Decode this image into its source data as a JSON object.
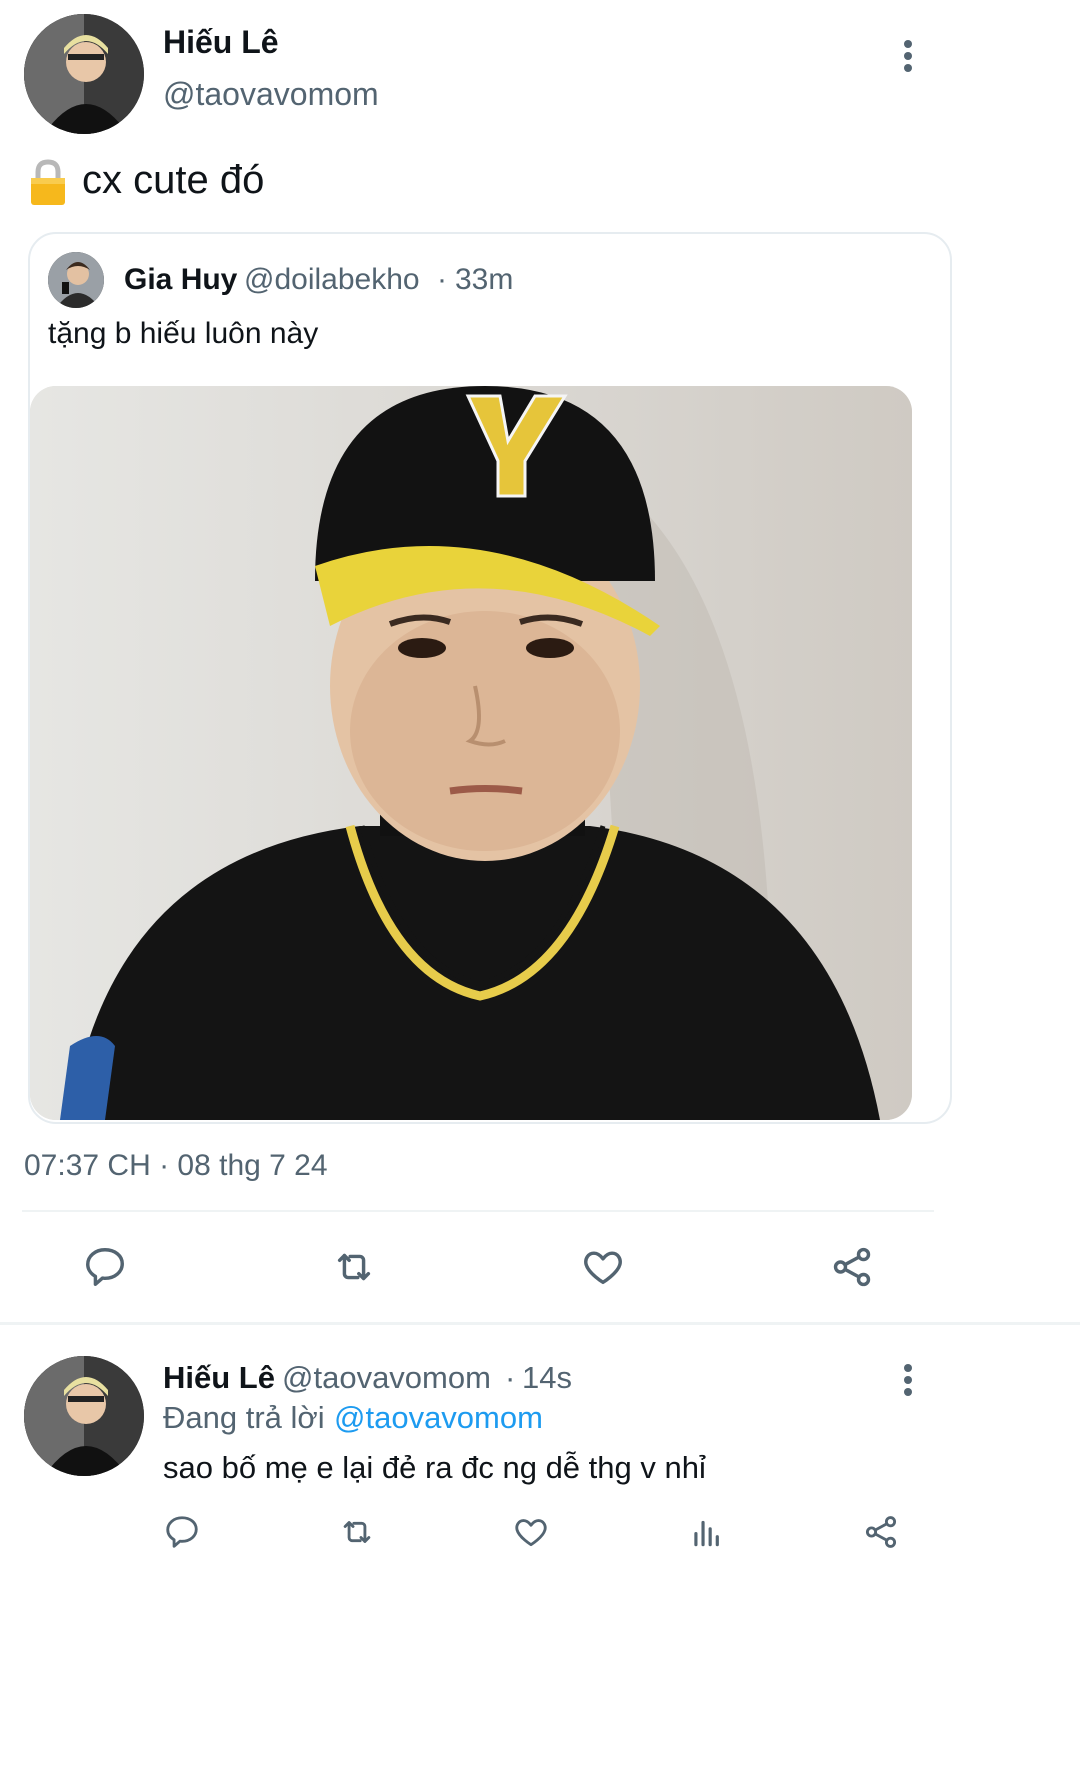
{
  "main_tweet": {
    "author_name": "Hiếu Lê",
    "author_handle": "@taovavomom",
    "text_icon": "lock-icon",
    "text": "cx cute đó",
    "quoted": {
      "author_name": "Gia Huy",
      "author_handle": "@doilabekho",
      "separator": "·",
      "time_ago": "33m",
      "text": "tặng b hiếu luôn này",
      "image": "photo-boy-in-yellow-black-cap"
    },
    "timestamp": "07:37 CH · 08 thg 7 24",
    "actions": [
      "reply-icon",
      "retweet-icon",
      "like-icon",
      "share-icon"
    ]
  },
  "reply_tweet": {
    "author_name": "Hiếu Lê",
    "author_handle": "@taovavomom",
    "separator": "·",
    "time_ago": "14s",
    "replying_prefix": "Đang trả lời",
    "replying_to": "@taovavomom",
    "text": "sao bố mẹ e lại đẻ ra đc ng dễ thg v nhỉ",
    "actions": [
      "reply-icon",
      "retweet-icon",
      "like-icon",
      "analytics-icon",
      "share-icon"
    ]
  },
  "colors": {
    "accent": "#1d9bf0",
    "muted": "#536471",
    "divider": "#eff3f4"
  }
}
